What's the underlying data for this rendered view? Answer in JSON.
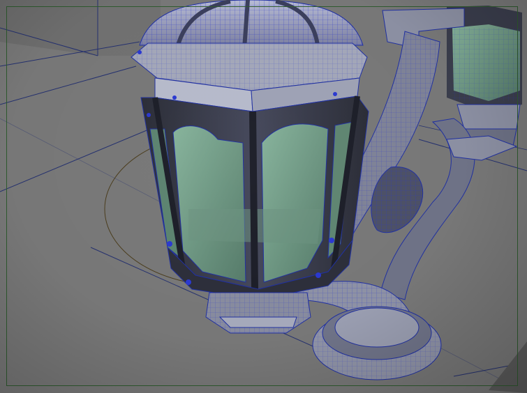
{
  "viewport": {
    "label": "",
    "camera": "perspective",
    "display_mode": "wireframe-on-shaded"
  },
  "colors": {
    "background": "#747474",
    "floor": "#7a7a7a",
    "grid": "#1f2a6e",
    "wire": "#1e2cc0",
    "metal_light": "#9ea3b6",
    "metal_dark": "#3b3d4a",
    "glass": "#6f9c86",
    "manipulator": "#5a4a1e",
    "render_region": "#2e5a2e"
  },
  "icons": {
    "manipulator": "rotate-manipulator-icon"
  }
}
